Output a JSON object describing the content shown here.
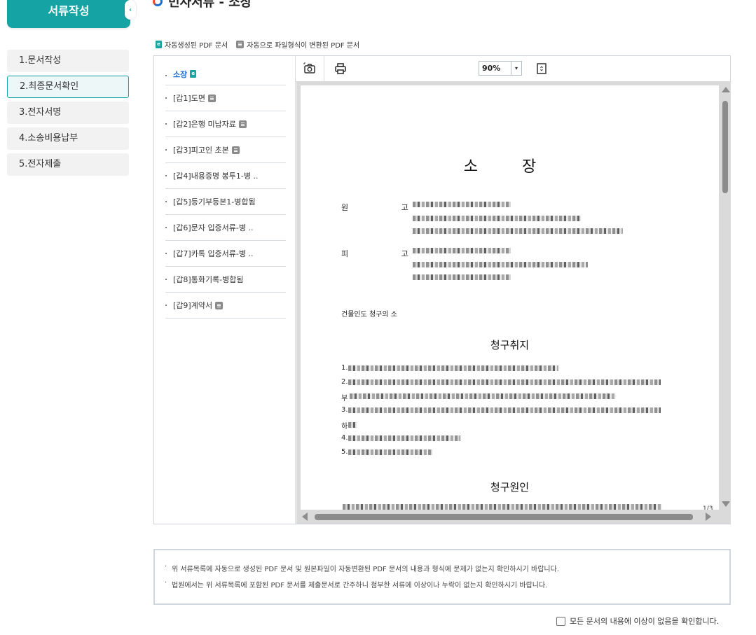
{
  "nav": {
    "header": "서류작성",
    "collapse_glyph": "‹",
    "steps": [
      {
        "label": "1.문서작성",
        "active": false
      },
      {
        "label": "2.최종문서확인",
        "active": true
      },
      {
        "label": "3.전자서명",
        "active": false
      },
      {
        "label": "4.소송비용납부",
        "active": false
      },
      {
        "label": "5.전자제출",
        "active": false
      }
    ]
  },
  "page": {
    "title": "민사서류 - 소장"
  },
  "legend": {
    "auto_pdf": "자동생성된 PDF 문서",
    "converted_pdf": "자동으로 파일형식이 변환된 PDF 문서"
  },
  "documents": [
    {
      "label": "소장",
      "icon": "auto-pdf-icon"
    },
    {
      "label": "[갑1]도면",
      "icon": "converted-pdf-icon"
    },
    {
      "label": "[갑2]은행 미납자료",
      "icon": "converted-pdf-icon"
    },
    {
      "label": "[갑3]피고인 초본",
      "icon": "converted-pdf-icon"
    },
    {
      "label": "[갑4]내용증명 봉투1-병 ..",
      "icon": ""
    },
    {
      "label": "[갑5]등기부등본1-병합됨",
      "icon": ""
    },
    {
      "label": "[갑6]문자 입증서류-병 ..",
      "icon": ""
    },
    {
      "label": "[갑7]카톡 입증서류-병 ..",
      "icon": ""
    },
    {
      "label": "[갑8]통화기록-병합됨",
      "icon": ""
    },
    {
      "label": "[갑9]계약서",
      "icon": "converted-pdf-icon"
    }
  ],
  "viewer": {
    "zoom": "90%",
    "page_indicator": "1/3",
    "doc": {
      "title": "소 장",
      "plaintiff_label": "원 고",
      "defendant_label": "피 고",
      "case_name": "건물인도 청구의 소",
      "claim_heading": "청구취지",
      "claim_numbers": [
        "1.",
        "2.",
        "부",
        "3.",
        "하",
        "4.",
        "5."
      ],
      "cause_heading": "청구원인"
    }
  },
  "notice": {
    "lines": [
      "위 서류목록에 자동으로 생성된 PDF 문서 및 원본파일이 자동변환된 PDF 문서의 내용과 형식에 문제가 없는지 확인하시기 바랍니다.",
      "법원에서는 위 서류목록에 포함된 PDF 문서를 제출문서로 간주하니 첨부한 서류에 이상이나 누락이 없는지 확인하시기 바랍니다."
    ]
  },
  "confirm": {
    "label": "모든 문서의 내용에 이상이 없음을 확인합니다.",
    "checked": false
  },
  "colors": {
    "accent": "#16a3a3",
    "link": "#1d6fd0"
  }
}
